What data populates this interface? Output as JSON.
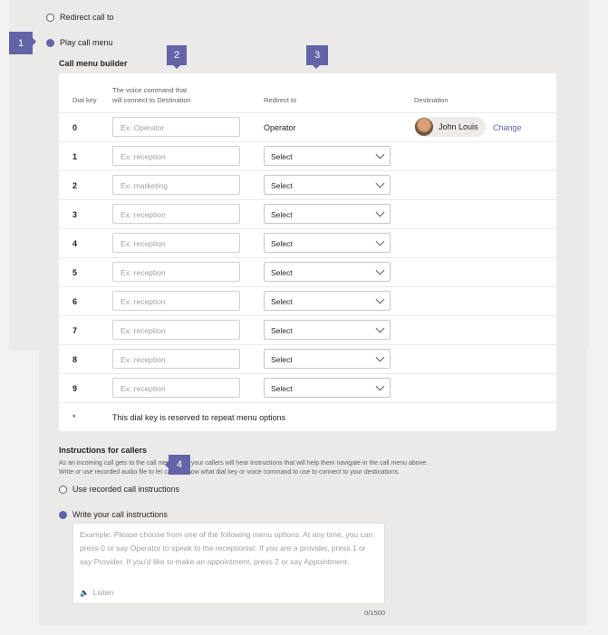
{
  "options": {
    "redirect": "Redirect call to",
    "play_menu": "Play call menu",
    "selected": "play_menu"
  },
  "builder": {
    "title": "Call menu builder",
    "headers": {
      "dial_key": "Dial key",
      "voice_line1": "The voice command that",
      "voice_line2": "will connect to Destination",
      "redirect": "Redirect to",
      "destination": "Destination"
    },
    "operator_row": {
      "key": "0",
      "placeholder": "Ex: Operator",
      "redirect": "Operator",
      "destination_name": "John Louis",
      "change": "Change"
    },
    "rows": [
      {
        "key": "1",
        "placeholder": "Ex: reception",
        "select": "Select"
      },
      {
        "key": "2",
        "placeholder": "Ex: marketing",
        "select": "Select"
      },
      {
        "key": "3",
        "placeholder": "Ex: reception",
        "select": "Select"
      },
      {
        "key": "4",
        "placeholder": "Ex: reception",
        "select": "Select"
      },
      {
        "key": "5",
        "placeholder": "Ex: reception",
        "select": "Select"
      },
      {
        "key": "6",
        "placeholder": "Ex: reception",
        "select": "Select"
      },
      {
        "key": "7",
        "placeholder": "Ex: reception",
        "select": "Select"
      },
      {
        "key": "8",
        "placeholder": "Ex: reception",
        "select": "Select"
      },
      {
        "key": "9",
        "placeholder": "Ex: reception",
        "select": "Select"
      }
    ],
    "star_row": {
      "key": "*",
      "text": "This dial key is reserved to repeat menu options"
    }
  },
  "instructions": {
    "title": "Instructions for callers",
    "desc1": "As an incoming call gets to the call menu step, your callers will hear instructions that will help them navigate in the call menu above.",
    "desc2": "Write or use recorded audio file to let callers know what dial key or voice command to use to connect to your destinations.",
    "recorded": "Use recorded call instructions",
    "write": "Write your call instructions",
    "selected": "write",
    "placeholder": "Example: Please choose from one of the following menu options. At any time, you can press 0 or say Operator to speak to the receptionist. If you are a provider, press 1 or say Provider. If you'd like to make an appointment, press 2 or say Appointment.",
    "listen": "Listen",
    "counter": "0/1500"
  },
  "callouts": [
    "1",
    "2",
    "3",
    "4"
  ],
  "accent": "#6264a7"
}
